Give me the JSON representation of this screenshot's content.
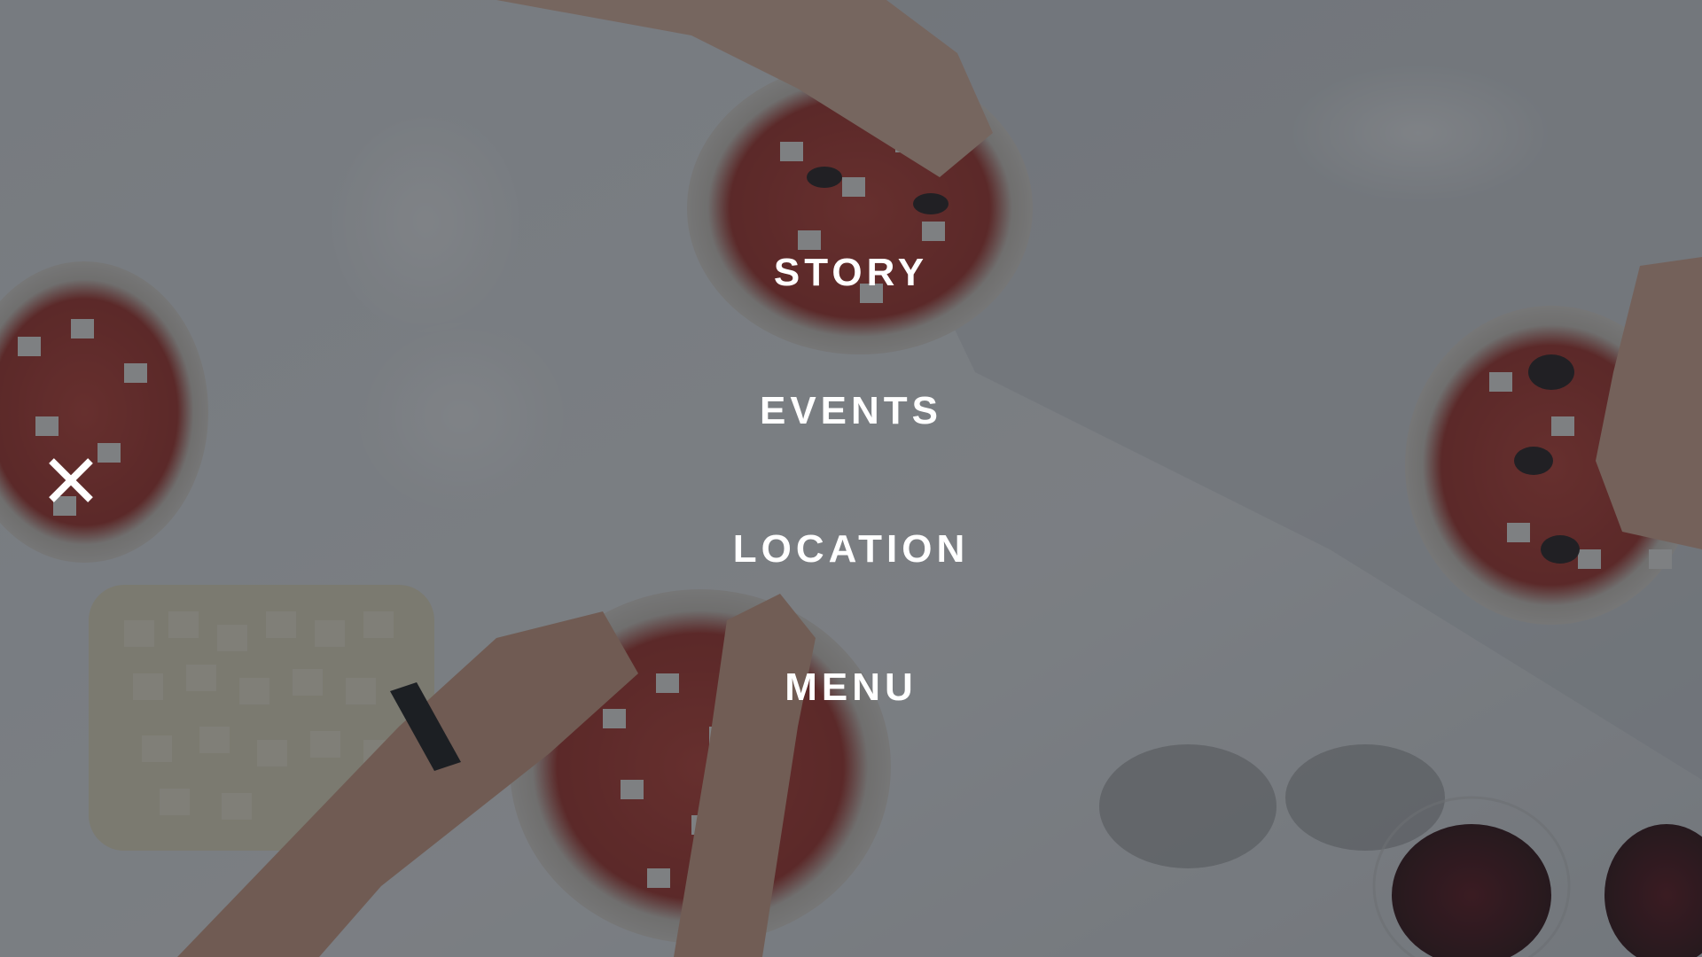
{
  "nav": {
    "items": [
      {
        "label": "STORY"
      },
      {
        "label": "EVENTS"
      },
      {
        "label": "LOCATION"
      },
      {
        "label": "MENU"
      }
    ]
  },
  "close": {
    "icon": "close-icon"
  },
  "colors": {
    "text": "#ffffff",
    "overlay": "#242a30"
  }
}
